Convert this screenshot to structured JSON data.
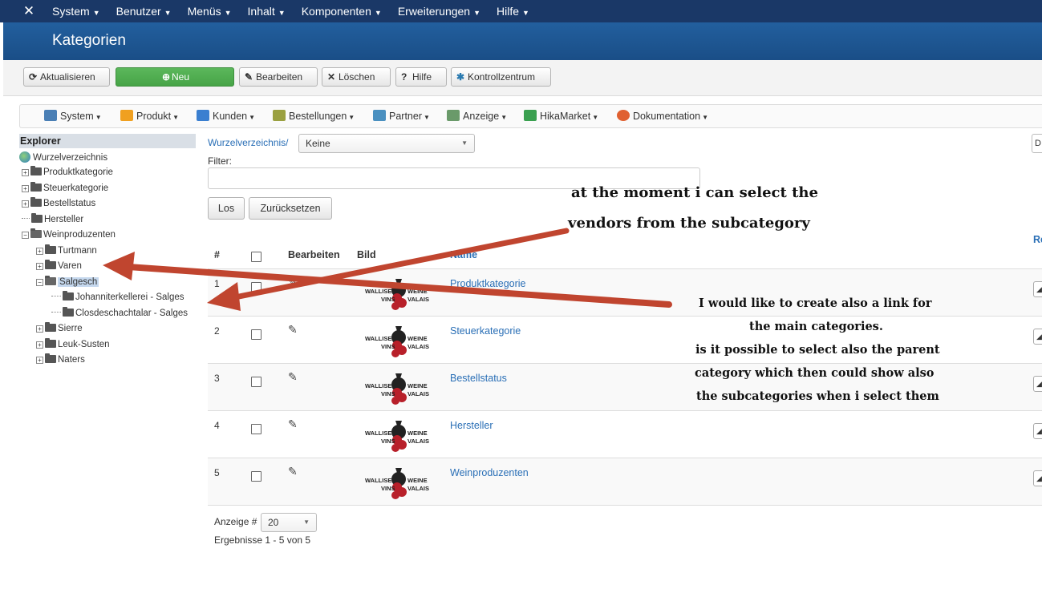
{
  "topnav": {
    "logo": "✕",
    "items": [
      "System",
      "Benutzer",
      "Menüs",
      "Inhalt",
      "Komponenten",
      "Erweiterungen",
      "Hilfe"
    ]
  },
  "title": "Kategorien",
  "toolbar": {
    "refresh": "Aktualisieren",
    "new": "Neu",
    "edit": "Bearbeiten",
    "delete": "Löschen",
    "help": "Hilfe",
    "control": "Kontrollzentrum"
  },
  "hikamenu": {
    "items": [
      "System",
      "Produkt",
      "Kunden",
      "Bestellungen",
      "Partner",
      "Anzeige",
      "HikaMarket",
      "Dokumentation"
    ],
    "icon_colors": [
      "#4a7fb5",
      "#f0a020",
      "#3a7fd0",
      "#9aa040",
      "#4a90c0",
      "#6a9a6a",
      "#3aa050",
      "#e06030"
    ]
  },
  "explorer": {
    "title": "Explorer",
    "root": "Wurzelverzeichnis",
    "nodes": [
      "Produktkategorie",
      "Steuerkategorie",
      "Bestellstatus",
      "Hersteller",
      "Weinproduzenten",
      "Turtmann",
      "Varen",
      "Salgesch",
      "Johanniterkellerei - Salges",
      "Closdeschachtalar - Salges",
      "Sierre",
      "Leuk-Susten",
      "Naters"
    ]
  },
  "filterbar": {
    "breadcrumb": "Wurzelverzeichnis/",
    "select_value": "Keine",
    "filter_label": "Filter:",
    "filter_value": "",
    "go": "Los",
    "reset": "Zurücksetzen",
    "right_btn": "D"
  },
  "table": {
    "headers": {
      "num": "#",
      "edit": "Bearbeiten",
      "image": "Bild",
      "name": "Name",
      "right": "Re"
    },
    "rows": [
      {
        "num": "1",
        "name": "Produktkategorie"
      },
      {
        "num": "2",
        "name": "Steuerkategorie"
      },
      {
        "num": "3",
        "name": "Bestellstatus"
      },
      {
        "num": "4",
        "name": "Hersteller"
      },
      {
        "num": "5",
        "name": "Weinproduzenten"
      }
    ],
    "logo_text": {
      "left_top": "WALLISER",
      "left_bottom": "VINS",
      "right_top": "WEINE",
      "right_bottom": "VALAIS"
    }
  },
  "pager": {
    "label": "Anzeige #",
    "value": "20",
    "results": "Ergebnisse 1 - 5 von 5"
  },
  "annotations": {
    "a_line1": "at the moment i can select the",
    "a_line2": "vendors from the subcategory",
    "b_line1": "I would like to create also a link for",
    "b_line2": "the main categories.",
    "b_line3": "is it possible to select also the parent",
    "b_line4": "category which then could show also",
    "b_line5": "the subcategories when i select them",
    "arrow_color": "#c0452f"
  }
}
